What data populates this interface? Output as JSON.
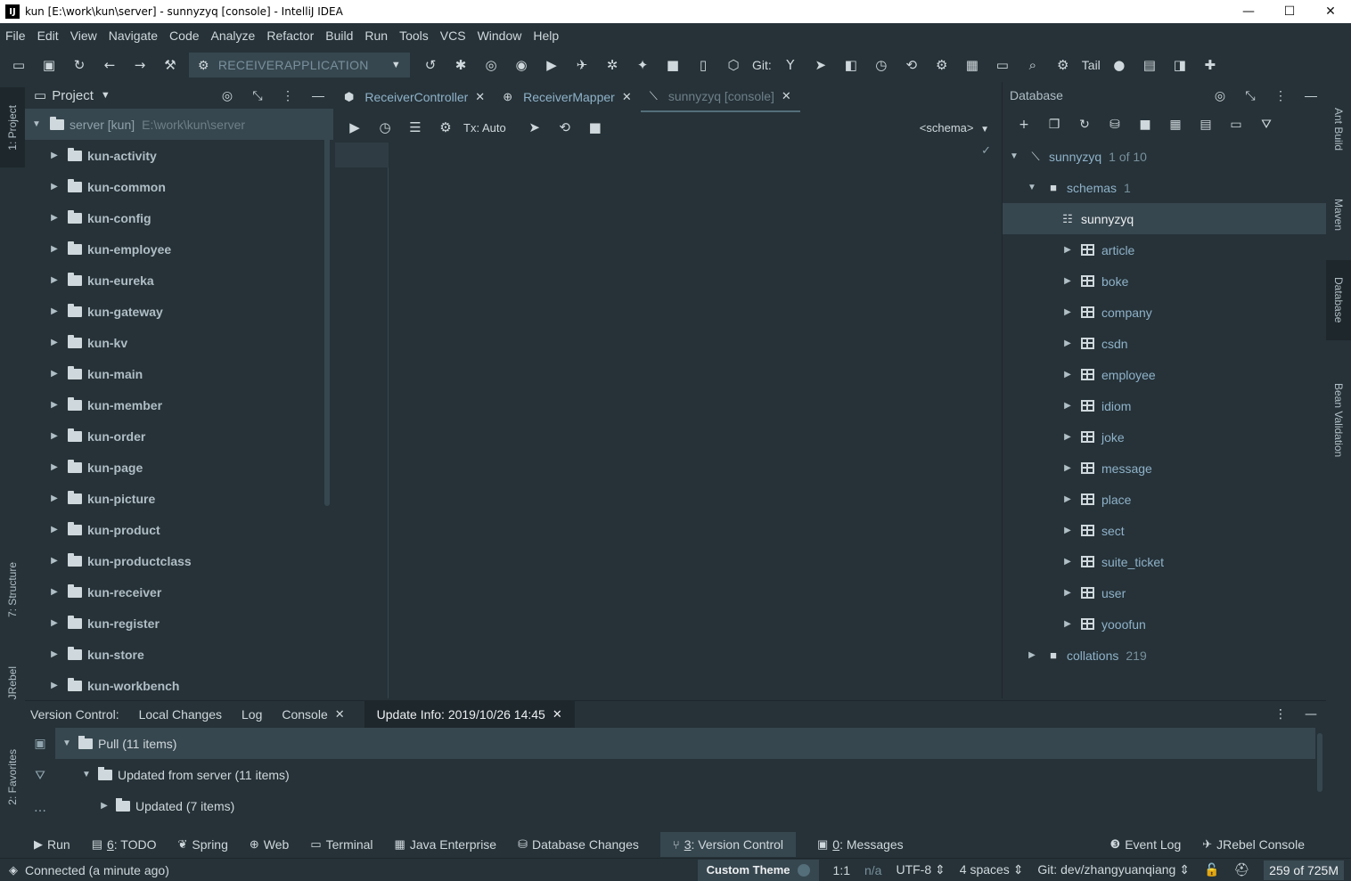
{
  "window": {
    "title": "kun [E:\\work\\kun\\server] - sunnyzyq [console] - IntelliJ IDEA",
    "app_icon": "IJ",
    "minimize": "—",
    "maximize": "☐",
    "close": "✕"
  },
  "menu": [
    "File",
    "Edit",
    "View",
    "Navigate",
    "Code",
    "Analyze",
    "Refactor",
    "Build",
    "Run",
    "Tools",
    "VCS",
    "Window",
    "Help"
  ],
  "toolbar": {
    "run_config": "RECEIVERAPPLICATION",
    "git_label": "Git:",
    "tail_label": "Tail"
  },
  "left_stripe": {
    "project": "1: Project",
    "structure": "7: Structure",
    "jrebel": "JRebel",
    "favorites": "2: Favorites"
  },
  "right_stripe": {
    "ant": "Ant Build",
    "maven": "Maven",
    "database": "Database",
    "bean": "Bean Validation"
  },
  "project": {
    "title": "Project",
    "root": {
      "name": "server [kun]",
      "path": "E:\\work\\kun\\server"
    },
    "modules": [
      "kun-activity",
      "kun-common",
      "kun-config",
      "kun-employee",
      "kun-eureka",
      "kun-gateway",
      "kun-kv",
      "kun-main",
      "kun-member",
      "kun-order",
      "kun-page",
      "kun-picture",
      "kun-product",
      "kun-productclass",
      "kun-receiver",
      "kun-register",
      "kun-store",
      "kun-workbench"
    ]
  },
  "editor": {
    "tabs": [
      {
        "label": "ReceiverController",
        "close": "✕"
      },
      {
        "label": "ReceiverMapper",
        "close": "✕"
      },
      {
        "label": "sunnyzyq [console]",
        "close": "✕"
      }
    ],
    "tx_mode": "Tx: Auto",
    "schema": "<schema>"
  },
  "database": {
    "title": "Database",
    "datasource": {
      "name": "sunnyzyq",
      "count": "1 of 10"
    },
    "schemas": {
      "name": "schemas",
      "count": "1"
    },
    "schema": "sunnyzyq",
    "tables": [
      "article",
      "boke",
      "company",
      "csdn",
      "employee",
      "idiom",
      "joke",
      "message",
      "place",
      "sect",
      "suite_ticket",
      "user",
      "yooofun"
    ],
    "collations": {
      "name": "collations",
      "count": "219"
    }
  },
  "version_control": {
    "label": "Version Control:",
    "tabs": [
      "Local Changes",
      "Log",
      "Console"
    ],
    "active_tab": "Update Info: 2019/10/26 14:45",
    "rows": [
      "Pull (11 items)",
      "Updated from server (11 items)",
      "Updated (7 items)"
    ]
  },
  "bottom_tabs": [
    {
      "icon": "▶",
      "num": "",
      "label": "Run"
    },
    {
      "icon": "▤",
      "num": "6",
      "label": ": TODO"
    },
    {
      "icon": "❦",
      "num": "",
      "label": "Spring"
    },
    {
      "icon": "⊕",
      "num": "",
      "label": "Web"
    },
    {
      "icon": "▭",
      "num": "",
      "label": "Terminal"
    },
    {
      "icon": "▦",
      "num": "",
      "label": "Java Enterprise"
    },
    {
      "icon": "⛁",
      "num": "",
      "label": "Database Changes"
    },
    {
      "icon": "⑂",
      "num": "3",
      "label": ": Version Control"
    },
    {
      "icon": "▣",
      "num": "0",
      "label": ": Messages"
    }
  ],
  "bottom_tabs_right": [
    {
      "icon": "❸",
      "label": "Event Log"
    },
    {
      "icon": "✈",
      "label": "JRebel Console"
    }
  ],
  "status": {
    "connection": "Connected (a minute ago)",
    "theme": "Custom Theme",
    "position": "1:1",
    "na": "n/a",
    "encoding": "UTF-8 ⇕",
    "indent": "4 spaces ⇕",
    "git_branch": "Git: dev/zhangyuanqiang ⇕",
    "memory": "259 of 725M"
  },
  "colors": {
    "background": "#263238",
    "selection": "#37474f",
    "tab_text": "#8fb2c9"
  }
}
